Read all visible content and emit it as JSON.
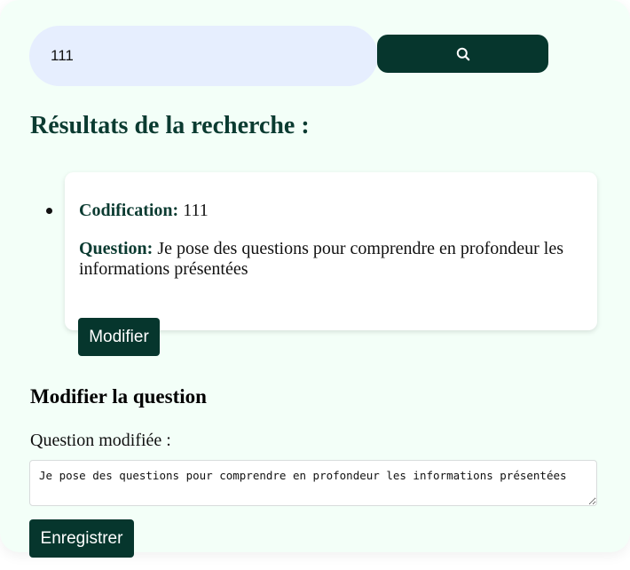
{
  "search": {
    "value": "111",
    "button_icon": "search-icon"
  },
  "results": {
    "title": "Résultats de la recherche :",
    "items": [
      {
        "codification_label": "Codification:",
        "codification_value": "111",
        "question_label": "Question:",
        "question_value": "Je pose des questions pour comprendre en profondeur les informations présentées",
        "modify_label": "Modifier"
      }
    ]
  },
  "edit": {
    "title": "Modifier la question",
    "field_label": "Question modifiée :",
    "field_value": "Je pose des questions pour comprendre en profondeur les informations présentées",
    "save_label": "Enregistrer"
  },
  "colors": {
    "page_background": "#f3fff8",
    "primary": "#06362d",
    "heading": "#0b3b31",
    "search_field_background": "#e6eefe"
  }
}
